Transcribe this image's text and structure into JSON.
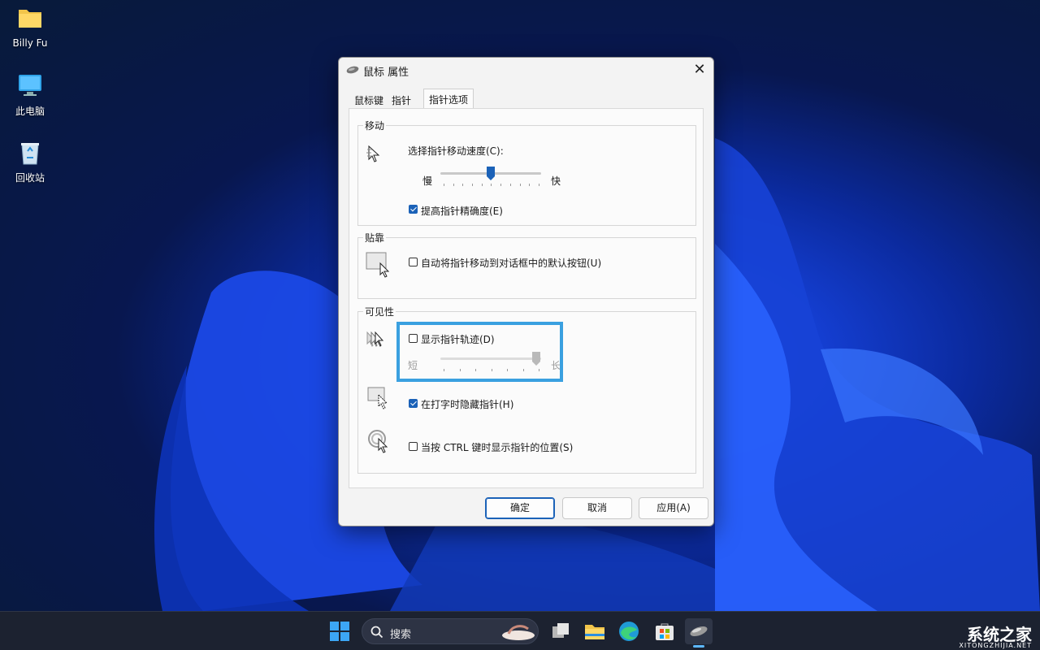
{
  "desktop": {
    "icons": [
      {
        "label": "Billy Fu",
        "icon": "folder-icon"
      },
      {
        "label": "此电脑",
        "icon": "computer-icon"
      },
      {
        "label": "回收站",
        "icon": "recycle-bin-icon"
      }
    ]
  },
  "dialog": {
    "title": "鼠标 属性",
    "close_label": "✕",
    "tabs": [
      {
        "label": "鼠标键",
        "active": false
      },
      {
        "label": "指针",
        "active": false
      },
      {
        "label": "指针选项",
        "active": true
      }
    ],
    "motion": {
      "legend": "移动",
      "speed_label": "选择指针移动速度(C):",
      "slow_label": "慢",
      "fast_label": "快",
      "speed_level": 0.5,
      "precision_label": "提高指针精确度(E)",
      "precision_checked": true
    },
    "snap": {
      "legend": "贴靠",
      "snap_label": "自动将指针移动到对话框中的默认按钮(U)",
      "snap_checked": false
    },
    "visibility": {
      "legend": "可见性",
      "trails_label": "显示指针轨迹(D)",
      "trails_checked": false,
      "short_label": "短",
      "long_label": "长",
      "trails_level": 0.95,
      "hide_label": "在打字时隐藏指针(H)",
      "hide_checked": true,
      "ctrl_label": "当按 CTRL 键时显示指针的位置(S)",
      "ctrl_checked": false
    },
    "buttons": {
      "ok": "确定",
      "cancel": "取消",
      "apply": "应用(A)"
    }
  },
  "taskbar": {
    "search_placeholder": "搜索",
    "watermark": "系统之家",
    "watermark_sub": "XITONGZHIJIA.NET"
  },
  "colors": {
    "accent": "#1b62b8",
    "highlight": "#3aa0e0",
    "taskbar": "#1c2230"
  }
}
